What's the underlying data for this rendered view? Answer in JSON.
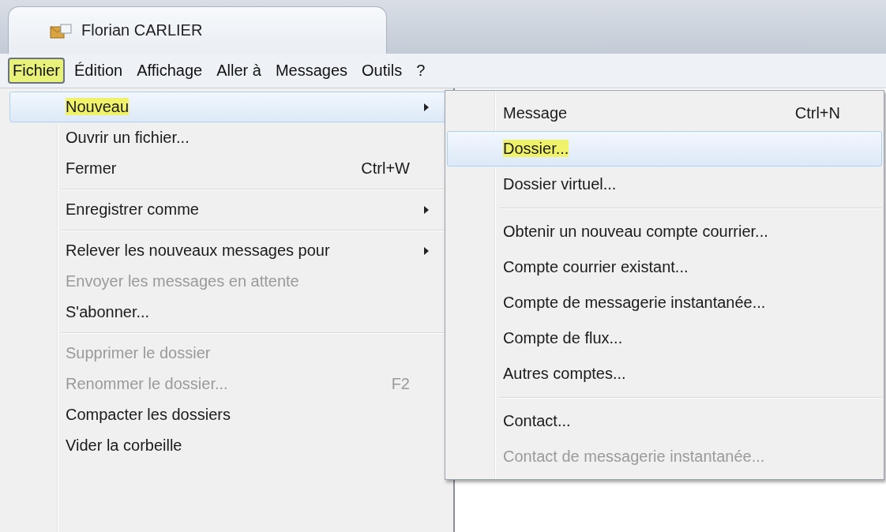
{
  "tab": {
    "title": "Florian CARLIER"
  },
  "menubar": [
    {
      "label": "Fichier",
      "selected": true
    },
    {
      "label": "Édition",
      "selected": false
    },
    {
      "label": "Affichage",
      "selected": false
    },
    {
      "label": "Aller à",
      "selected": false
    },
    {
      "label": "Messages",
      "selected": false
    },
    {
      "label": "Outils",
      "selected": false
    },
    {
      "label": "?",
      "selected": false
    }
  ],
  "menu": [
    {
      "kind": "item",
      "label": "Nouveau",
      "submenu": true,
      "selected": true,
      "disabled": false
    },
    {
      "kind": "item",
      "label": "Ouvrir un fichier...",
      "submenu": false,
      "selected": false,
      "disabled": false
    },
    {
      "kind": "item",
      "label": "Fermer",
      "shortcut": "Ctrl+W",
      "submenu": false,
      "selected": false,
      "disabled": false
    },
    {
      "kind": "separator"
    },
    {
      "kind": "item",
      "label": "Enregistrer comme",
      "submenu": true,
      "selected": false,
      "disabled": false
    },
    {
      "kind": "separator"
    },
    {
      "kind": "item",
      "label": "Relever les nouveaux messages pour",
      "submenu": true,
      "selected": false,
      "disabled": false
    },
    {
      "kind": "item",
      "label": "Envoyer les messages en attente",
      "submenu": false,
      "selected": false,
      "disabled": true
    },
    {
      "kind": "item",
      "label": "S'abonner...",
      "submenu": false,
      "selected": false,
      "disabled": false
    },
    {
      "kind": "separator"
    },
    {
      "kind": "item",
      "label": "Supprimer le dossier",
      "submenu": false,
      "selected": false,
      "disabled": true
    },
    {
      "kind": "item",
      "label": "Renommer le dossier...",
      "shortcut": "F2",
      "submenu": false,
      "selected": false,
      "disabled": true
    },
    {
      "kind": "item",
      "label": "Compacter les dossiers",
      "submenu": false,
      "selected": false,
      "disabled": false
    },
    {
      "kind": "item",
      "label": "Vider la corbeille",
      "submenu": false,
      "selected": false,
      "disabled": false
    }
  ],
  "submenu": [
    {
      "kind": "item",
      "label": "Message",
      "shortcut": "Ctrl+N",
      "selected": false,
      "disabled": false
    },
    {
      "kind": "item",
      "label": "Dossier...",
      "selected": true,
      "disabled": false
    },
    {
      "kind": "item",
      "label": "Dossier virtuel...",
      "selected": false,
      "disabled": false
    },
    {
      "kind": "separator"
    },
    {
      "kind": "item",
      "label": "Obtenir un nouveau compte courrier...",
      "selected": false,
      "disabled": false
    },
    {
      "kind": "item",
      "label": "Compte courrier existant...",
      "selected": false,
      "disabled": false
    },
    {
      "kind": "item",
      "label": "Compte de messagerie instantanée...",
      "selected": false,
      "disabled": false
    },
    {
      "kind": "item",
      "label": "Compte de flux...",
      "selected": false,
      "disabled": false
    },
    {
      "kind": "item",
      "label": "Autres comptes...",
      "selected": false,
      "disabled": false
    },
    {
      "kind": "separator"
    },
    {
      "kind": "item",
      "label": "Contact...",
      "selected": false,
      "disabled": false
    },
    {
      "kind": "item",
      "label": "Contact de messagerie instantanée...",
      "selected": false,
      "disabled": true
    }
  ]
}
